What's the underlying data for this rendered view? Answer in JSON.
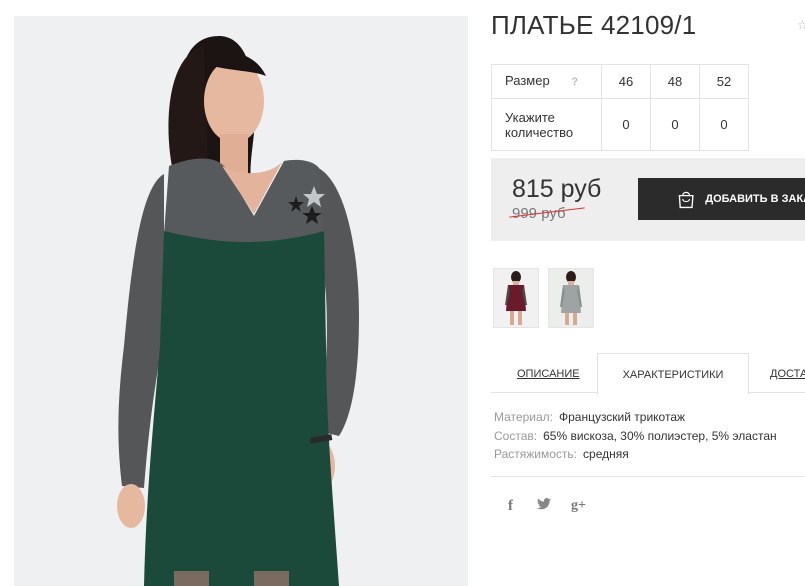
{
  "product": {
    "title": "ПЛАТЬЕ 42109/1"
  },
  "sizes": {
    "header_label": "Размер",
    "help_icon": "?",
    "values": [
      "46",
      "48",
      "52"
    ],
    "qty_label_line1": "Укажите",
    "qty_label_line2": "количество",
    "quantities": [
      "0",
      "0",
      "0"
    ]
  },
  "price": {
    "current": "815 руб",
    "old": "999 руб"
  },
  "cart": {
    "add_label": "ДОБАВИТЬ В ЗАКАЗ",
    "icon": "shopping-bag-icon"
  },
  "tabs": [
    {
      "label": "ОПИСАНИЕ",
      "active": false
    },
    {
      "label": "ХАРАКТЕРИСТИКИ",
      "active": true
    },
    {
      "label": "ДОСТАВКА",
      "active": false
    }
  ],
  "specs": [
    {
      "key": "Материал:",
      "value": "Французский трикотаж"
    },
    {
      "key": "Состав:",
      "value": "65% вискоза, 30% полиэстер, 5% эластан"
    },
    {
      "key": "Растяжимость:",
      "value": "средняя"
    }
  ],
  "social": {
    "facebook": "f",
    "twitter": "🐦",
    "googleplus": "g+"
  },
  "colors": {
    "dress_green": "#1c4a3a",
    "dress_grey": "#545658",
    "button_dark": "#2b2b2b",
    "price_bg": "#eeeeee",
    "strike_red": "#dd3333"
  }
}
